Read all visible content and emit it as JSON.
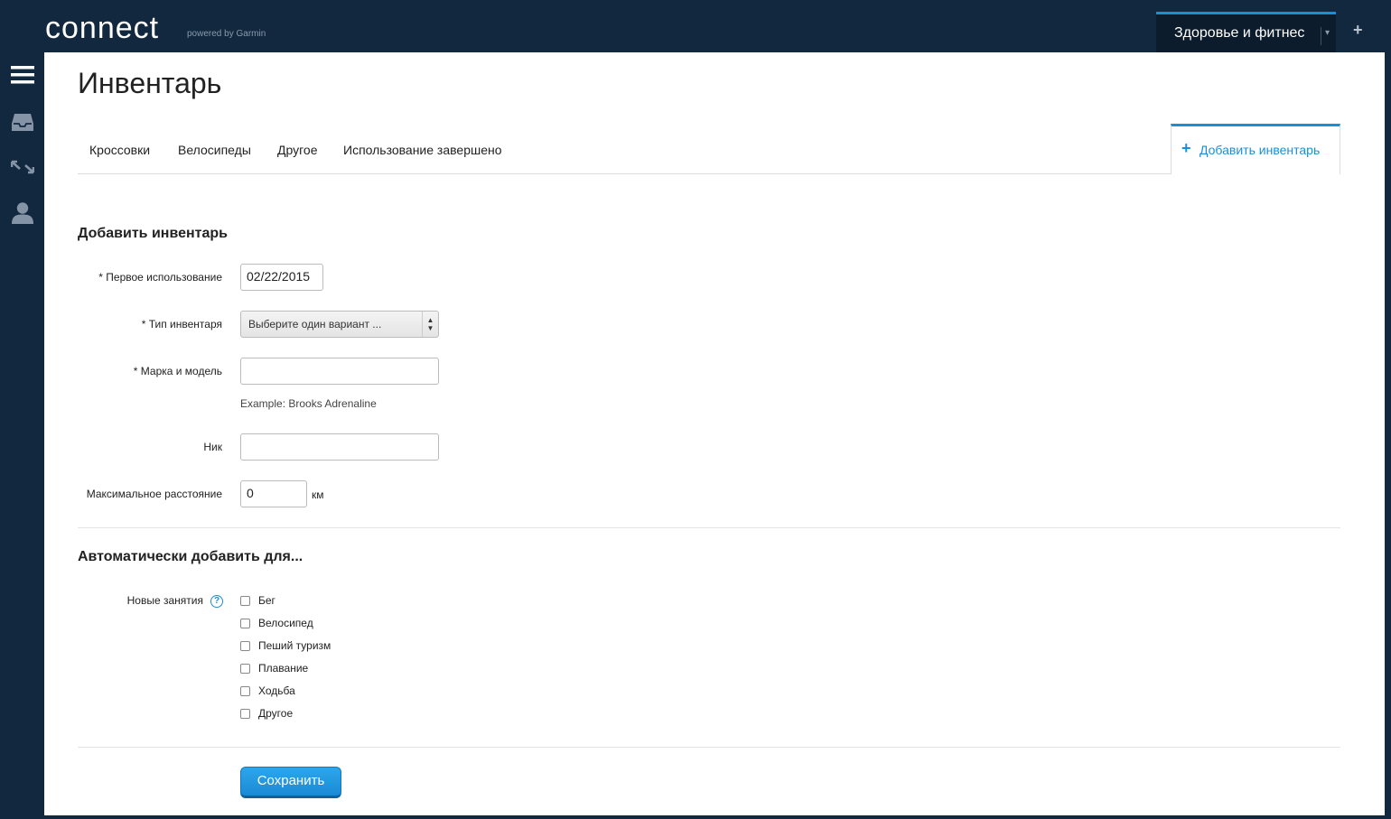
{
  "topbar": {
    "logo": "connect",
    "powered_by": "powered by Garmin",
    "context_tab": "Здоровье и фитнес",
    "context_caret": "▾",
    "add": "+"
  },
  "sidebar": {
    "icons": [
      "menu-icon",
      "inbox-icon",
      "sync-icon",
      "user-icon"
    ]
  },
  "page": {
    "title": "Инвентарь"
  },
  "tabs": [
    {
      "label": "Кроссовки"
    },
    {
      "label": "Велосипеды"
    },
    {
      "label": "Другое"
    },
    {
      "label": "Использование завершено"
    }
  ],
  "add_tab": {
    "plus": "+",
    "label": "Добавить инвентарь"
  },
  "form": {
    "section_title": "Добавить инвентарь",
    "first_use_label": "* Первое использование",
    "first_use_value": "02/22/2015",
    "type_label": "* Тип инвентаря",
    "type_value": "Выберите один вариант ...",
    "brand_label": "* Марка и модель",
    "brand_value": "",
    "brand_hint": "Example: Brooks Adrenaline",
    "nick_label": "Ник",
    "nick_value": "",
    "max_dist_label": "Максимальное расстояние",
    "max_dist_value": "0",
    "max_dist_unit": "км"
  },
  "auto": {
    "section_title": "Автоматически добавить для...",
    "new_activities_label": "Новые занятия",
    "help": "?",
    "options": [
      {
        "label": "Бег",
        "checked": false
      },
      {
        "label": "Велосипед",
        "checked": false
      },
      {
        "label": "Пеший туризм",
        "checked": false
      },
      {
        "label": "Плавание",
        "checked": false
      },
      {
        "label": "Ходьба",
        "checked": false
      },
      {
        "label": "Другое",
        "checked": false
      }
    ]
  },
  "save_label": "Сохранить",
  "colors": {
    "nav_bg": "#11283f",
    "accent": "#1a8fd8"
  }
}
